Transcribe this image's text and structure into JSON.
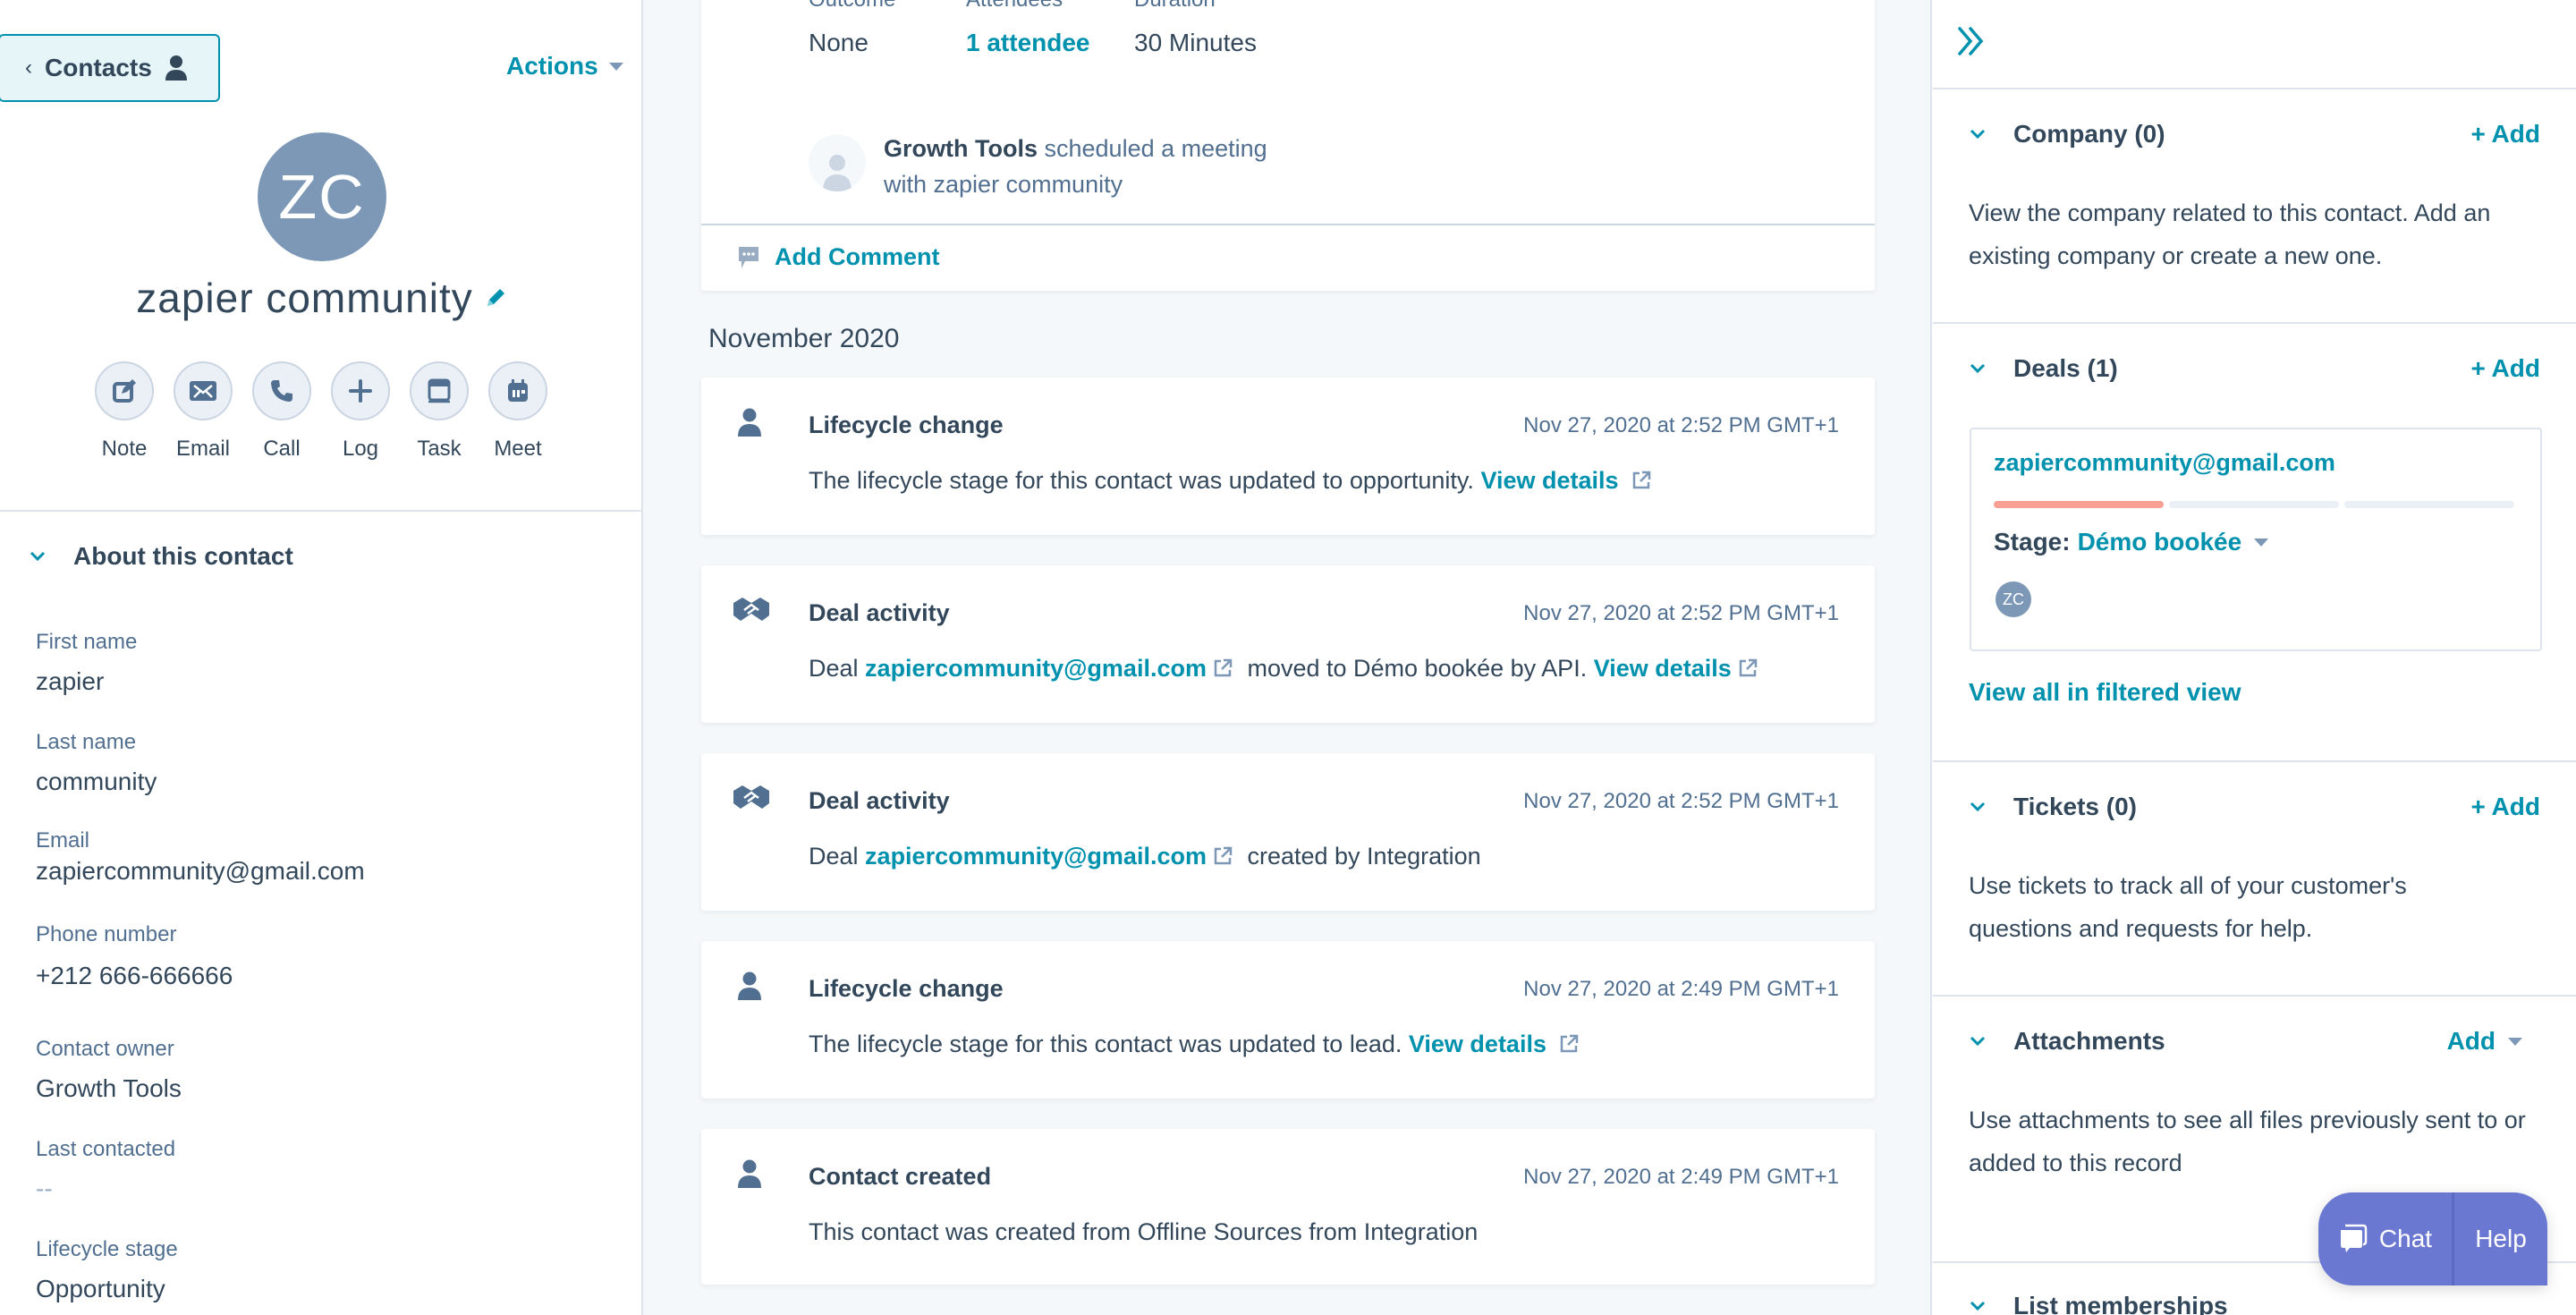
{
  "left_panel": {
    "back_button": {
      "label": "Contacts",
      "icon": "person-icon"
    },
    "actions_label": "Actions",
    "avatar_initials": "ZC",
    "contact_name": "zapier community",
    "quick_actions": [
      {
        "label": "Note",
        "icon": "note-edit-icon"
      },
      {
        "label": "Email",
        "icon": "envelope-icon"
      },
      {
        "label": "Call",
        "icon": "phone-icon"
      },
      {
        "label": "Log",
        "icon": "plus-icon"
      },
      {
        "label": "Task",
        "icon": "task-icon"
      },
      {
        "label": "Meet",
        "icon": "calendar-icon"
      }
    ],
    "about_section": {
      "title": "About this contact",
      "fields": [
        {
          "label": "First name",
          "value": "zapier"
        },
        {
          "label": "Last name",
          "value": "community"
        },
        {
          "label": "Email",
          "value": "zapiercommunity@gmail.com"
        },
        {
          "label": "Phone number",
          "value": "+212 666-666666"
        },
        {
          "label": "Contact owner",
          "value": "Growth Tools"
        },
        {
          "label": "Last contacted",
          "value": "--"
        },
        {
          "label": "Lifecycle stage",
          "value": "Opportunity"
        }
      ]
    }
  },
  "timeline": {
    "meeting_card": {
      "labels": [
        "Outcome",
        "Attendees",
        "Duration"
      ],
      "values": [
        "None",
        "1 attendee",
        "30 Minutes"
      ],
      "scheduler": "Growth Tools",
      "scheduled_text": "scheduled a meeting",
      "with_text": "with zapier community",
      "add_comment": "Add Comment"
    },
    "month_header": "November 2020",
    "events": [
      {
        "type": "lifecycle",
        "title": "Lifecycle change",
        "time": "Nov 27, 2020 at 2:52 PM GMT+1",
        "pre": "The lifecycle stage for this contact was updated to opportunity.",
        "link": "",
        "post": "",
        "view_details": "View details"
      },
      {
        "type": "deal",
        "title": "Deal activity",
        "time": "Nov 27, 2020 at 2:52 PM GMT+1",
        "pre": "Deal",
        "link": "zapiercommunity@gmail.com",
        "post": "moved to Démo bookée by API.",
        "view_details": "View details"
      },
      {
        "type": "deal",
        "title": "Deal activity",
        "time": "Nov 27, 2020 at 2:52 PM GMT+1",
        "pre": "Deal",
        "link": "zapiercommunity@gmail.com",
        "post": "created by Integration",
        "view_details": ""
      },
      {
        "type": "lifecycle",
        "title": "Lifecycle change",
        "time": "Nov 27, 2020 at 2:49 PM GMT+1",
        "pre": "The lifecycle stage for this contact was updated to lead.",
        "link": "",
        "post": "",
        "view_details": "View details"
      },
      {
        "type": "lifecycle",
        "title": "Contact created",
        "time": "Nov 27, 2020 at 2:49 PM GMT+1",
        "pre": "This contact was created from Offline Sources from Integration",
        "link": "",
        "post": "",
        "view_details": ""
      }
    ]
  },
  "right_panel": {
    "collapse_icon": "double-chevron-right-icon",
    "company": {
      "title": "Company (0)",
      "add_label": "+ Add",
      "description": "View the company related to this contact. Add an existing company or create a new one."
    },
    "deals": {
      "title": "Deals (1)",
      "add_label": "+ Add",
      "deal": {
        "name": "zapiercommunity@gmail.com",
        "stage_label": "Stage:",
        "stage_value": "Démo bookée",
        "progress_segments_filled": 1,
        "progress_segments_total": 3,
        "owner_initials": "ZC"
      },
      "view_all": "View all in filtered view"
    },
    "tickets": {
      "title": "Tickets (0)",
      "add_label": "+ Add",
      "description": "Use tickets to track all of your customer's questions and requests for help."
    },
    "attachments": {
      "title": "Attachments",
      "add_label": "Add",
      "description": "Use attachments to see all files previously sent to or added to this record"
    },
    "list_memberships": {
      "title": "List memberships"
    }
  },
  "chat_widget": {
    "chat_label": "Chat",
    "help_label": "Help"
  },
  "colors": {
    "accent": "#0091ae",
    "text": "#33475b",
    "muted": "#516f90",
    "avatar": "#7c98b6",
    "progress": "#f8a094",
    "chat": "#6a78d1"
  }
}
